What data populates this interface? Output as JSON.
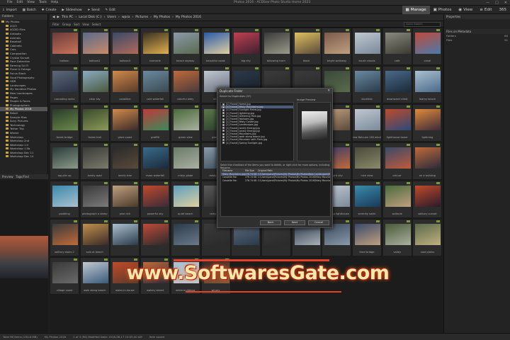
{
  "window": {
    "title": "Photos 2016 - ACDSee Photo Studio Home 2023",
    "menu": [
      "File",
      "Edit",
      "View",
      "Tools",
      "Help"
    ],
    "controls": [
      "—",
      "□",
      "✕"
    ]
  },
  "toolbar": {
    "buttons": [
      "Import",
      "Batch",
      "Create",
      "Slideshow",
      "Send",
      "Edit"
    ],
    "modes": [
      "Manage",
      "Photos",
      "View",
      "Edit",
      "365"
    ]
  },
  "address": {
    "path": [
      "This PC",
      "Local Disk (C:)",
      "Users",
      "wpsa",
      "Pictures",
      "My Photos",
      "My Photos 2016"
    ],
    "filters": [
      "Filter",
      "Group",
      "Sort",
      "View",
      "Select"
    ],
    "search_placeholder": "Quick Search"
  },
  "folders": {
    "header": "Folders",
    "items": [
      {
        "label": "My Photos",
        "sel": false
      },
      {
        "label": "2023",
        "sel": false
      },
      {
        "label": "ACDID Files",
        "sel": false
      },
      {
        "label": "Airboats",
        "sel": false
      },
      {
        "label": "Animals",
        "sel": false
      },
      {
        "label": "Baseball",
        "sel": false
      },
      {
        "label": "Cabinets",
        "sel": false
      },
      {
        "label": "Cars",
        "sel": false
      },
      {
        "label": "Composition",
        "sel": false
      },
      {
        "label": "Crystal Sunset",
        "sel": false
      },
      {
        "label": "Face Detection",
        "sel": false
      },
      {
        "label": "Farming Sci Fi",
        "sel": false
      },
      {
        "label": "Floral & Foliage",
        "sel": false
      },
      {
        "label": "Focus Stack",
        "sel": false
      },
      {
        "label": "Food Photography",
        "sel": false
      },
      {
        "label": "HDR",
        "sel": false
      },
      {
        "label": "Landscapes",
        "sel": false
      },
      {
        "label": "My Vacation Photos",
        "sel": false
      },
      {
        "label": "New Landscapes",
        "sel": false
      },
      {
        "label": "Pages",
        "sel": false
      },
      {
        "label": "People & Faces",
        "sel": false
      },
      {
        "label": "Photographers",
        "sel": false
      },
      {
        "label": "My Photos 2016",
        "sel": true
      },
      {
        "label": "Retail",
        "sel": false
      },
      {
        "label": "Sample Files",
        "sel": false
      },
      {
        "label": "Sony Pictures",
        "sel": false
      },
      {
        "label": "Technology",
        "sel": false
      },
      {
        "label": "Tether Trip",
        "sel": false
      },
      {
        "label": "Winter",
        "sel": false
      },
      {
        "label": "Workshop",
        "sel": false
      },
      {
        "label": "Workshop 2nd",
        "sel": false
      },
      {
        "label": "Workshop 1.0",
        "sel": false
      },
      {
        "label": "Workshop 1.5b",
        "sel": false
      },
      {
        "label": "Workshop Dec 11",
        "sel": false
      },
      {
        "label": "Workshop Dec 14",
        "sel": false
      }
    ]
  },
  "preview": {
    "header": "Preview",
    "tab": "Tags/Find"
  },
  "properties": {
    "header": "Properties",
    "section": "Files on Metadata",
    "rows": [
      {
        "k": "Folders",
        "v": "60"
      },
      {
        "k": "Files",
        "v": "51"
      }
    ]
  },
  "thumbs": [
    {
      "cap": "balloon",
      "c": "#6b3a3a,#c9745a"
    },
    {
      "cap": "balloon2",
      "c": "#5a6a8a,#c98a6a"
    },
    {
      "cap": "balloon3",
      "c": "#3a4a6a,#b06a5a"
    },
    {
      "cap": "barnacle",
      "c": "#3a3020,#e0b050"
    },
    {
      "cap": "beach skyway",
      "c": "#8a9aaa,#5a6a50"
    },
    {
      "cap": "beautiful coast",
      "c": "#2a5aaa,#e0d0a0"
    },
    {
      "cap": "big city",
      "c": "#c04050,#402030"
    },
    {
      "cap": "billowing tram",
      "c": "#3a3a3a,#9a9a8a"
    },
    {
      "cap": "block",
      "c": "#e0c060,#5a4a3a"
    },
    {
      "cap": "bright walkway",
      "c": "#7a5a4a,#c0a080"
    },
    {
      "cap": "brush clouds",
      "c": "#c0c8d0,#7a8a9a"
    },
    {
      "cap": "cafe",
      "c": "#8a8a80,#3a3a30"
    },
    {
      "cap": "canal",
      "c": "#c04a3a,#4a7aaa"
    },
    {
      "cap": "cascading rocks",
      "c": "#5a6a7a,#2a3040"
    },
    {
      "cap": "clear sky",
      "c": "#8aaac0,#4a5a40"
    },
    {
      "cap": "coastline",
      "c": "#d08a4a,#5a3a2a"
    },
    {
      "cap": "cold waterfall",
      "c": "#6a8aa0,#3a4a50"
    },
    {
      "cap": "colorful alley",
      "c": "#c06a3a,#4a3a3a"
    },
    {
      "cap": "city",
      "c": "#c0c8d0,#6a7080"
    },
    {
      "cap": "",
      "c": "#2a3a4a,#1a2028"
    },
    {
      "cap": "",
      "c": "#3a3a3a,#2a2a2a"
    },
    {
      "cap": "",
      "c": "#3a3a3a,#2a2a2a"
    },
    {
      "cap": "",
      "c": "#3a4a3a,#5a6a4a"
    },
    {
      "cap": "docktide",
      "c": "#6a8aa0,#2a3a4a"
    },
    {
      "cap": "downward climb",
      "c": "#4a6a8a,#1a2a3a"
    },
    {
      "cap": "foamy beach",
      "c": "#aac0d0,#4a6a8a"
    },
    {
      "cap": "forest bridge",
      "c": "#2a3a2a,#6a8a4a"
    },
    {
      "cap": "forest trail",
      "c": "#3a4a2a,#8a9a5a"
    },
    {
      "cap": "glare coast",
      "c": "#d08a4a,#3a2a2a"
    },
    {
      "cap": "graffiti",
      "c": "#c03a3a,#3a8a5a"
    },
    {
      "cap": "green view",
      "c": "#4a6a3a,#aab0a0"
    },
    {
      "cap": "green",
      "c": "#5a7a4a,#2a3a2a"
    },
    {
      "cap": "",
      "c": "#3a3a3a,#2a2a2a"
    },
    {
      "cap": "",
      "c": "#3a3a3a,#2a2a2a"
    },
    {
      "cap": "",
      "c": "#3a3a3a,#2a2a2a"
    },
    {
      "cap": "",
      "c": "#c0a080,#5a4a3a"
    },
    {
      "cap": "law Balcuan 180 wind",
      "c": "#c0c8d0,#7a8a9a"
    },
    {
      "cap": "lighthouse tower",
      "c": "#c04a2a,#2a4a7a"
    },
    {
      "cap": "lightning",
      "c": "#e08a3a,#3a2a3a"
    },
    {
      "cap": "log pile up",
      "c": "#2a3a3a,#8a9a8a"
    },
    {
      "cap": "lonely road",
      "c": "#3a3a3a,#7a7a6a"
    },
    {
      "cap": "lonely tree",
      "c": "#2a2a2a,#5a4a3a"
    },
    {
      "cap": "mass waterfall",
      "c": "#3a6a8a,#1a2a3a"
    },
    {
      "cap": "misty glade",
      "c": "#6a7a6a,#aab0a0"
    },
    {
      "cap": "misty pier",
      "c": "#8a9aaa,#3a4a5a"
    },
    {
      "cap": "",
      "c": "#3a3a3a,#2a2a2a"
    },
    {
      "cap": "",
      "c": "#3a3a3a,#2a2a2a"
    },
    {
      "cap": "",
      "c": "#3a3a3a,#2a2a2a"
    },
    {
      "cap": "night city",
      "c": "#3a3a6a,#c06a3a"
    },
    {
      "cap": "nice view",
      "c": "#4a4a3a,#8a8a6a"
    },
    {
      "cap": "old car",
      "c": "#3a4a6a,#c05a3a"
    },
    {
      "cap": "on a building",
      "c": "#c06a3a,#2a2a3a"
    },
    {
      "cap": "paddling",
      "c": "#3a8aaa,#aac0d0"
    },
    {
      "cap": "photograph a damp",
      "c": "#3a3a3a,#7a7a7a"
    },
    {
      "cap": "pine rich",
      "c": "#c0a080,#4a3a2a"
    },
    {
      "cap": "powerful sky",
      "c": "#c04a2a,#3a2a3a"
    },
    {
      "cap": "quiet beach",
      "c": "#5aa0c0,#e0d0a0"
    },
    {
      "cap": "rainy day",
      "c": "#5a5a5a,#2a2a2a"
    },
    {
      "cap": "rolling wave",
      "c": "#3a6a8a,#aac0d0"
    },
    {
      "cap": "sensual Mountains SDRMC",
      "c": "#6a6a7a,#2a2a3a"
    },
    {
      "cap": "skyscraper",
      "c": "#aab0b8,#4a5a6a"
    },
    {
      "cap": "smoking lighthouse",
      "c": "#c0c8d0,#7a8a9a"
    },
    {
      "cap": "serenity swim",
      "c": "#3a8aaa,#1a3a5a"
    },
    {
      "cap": "solitude",
      "c": "#4a6a3a,#c0a080"
    },
    {
      "cap": "solitary sunset",
      "c": "#c04a2a,#2a1a2a"
    },
    {
      "cap": "solitary stairs 2",
      "c": "#3a3a3a,#c06a3a"
    },
    {
      "cap": "solo at beach",
      "c": "#c0904a,#3a2a2a"
    },
    {
      "cap": "",
      "c": "#aac0d0,#2a3a4a"
    },
    {
      "cap": "",
      "c": "#c04a3a,#2a2a2a"
    },
    {
      "cap": "",
      "c": "#2a3a4a,#6a7a8a"
    },
    {
      "cap": "",
      "c": "#3a3a3a,#2a2a2a"
    },
    {
      "cap": "",
      "c": "#5a6a7a,#2a3a4a"
    },
    {
      "cap": "",
      "c": "#3a3a3a,#2a2a2a"
    },
    {
      "cap": "",
      "c": "#2a3a4a,#aab0b8"
    },
    {
      "cap": "",
      "c": "#3a4a5a,#8a9aaa"
    },
    {
      "cap": "tired bridge",
      "c": "#3a4a6a,#c0a080"
    },
    {
      "cap": "valley",
      "c": "#4a5a3a,#aab0a0"
    },
    {
      "cap": "vast plains",
      "c": "#5a6a4a,#c0b080"
    },
    {
      "cap": "village coast",
      "c": "#3a3a3a,#6a6a6a"
    },
    {
      "cap": "walk along beach",
      "c": "#c0c8d0,#3a5a7a"
    },
    {
      "cap": "water-in-house",
      "c": "#c04a2a,#5a3a2a"
    },
    {
      "cap": "watery street",
      "c": "#c06a3a,#2a2a3a"
    },
    {
      "cap": "white buildings",
      "c": "#aac0d0,#c0c8d0"
    },
    {
      "cap": "winery",
      "c": "#3a2a2a,#8a5a3a"
    }
  ],
  "dialog": {
    "title": "Duplicate Finder",
    "subtitle": "Select to Duplicates (37)",
    "files": [
      "[1] Found] forest.jpg",
      "[1] Found] Misty Mountains.jpg",
      "[1] Found] Sunlight Fields.jpg",
      "[1] Found] lightning.jpg",
      "[1] Found] Glittering Park.jpg",
      "[1] Found] fashown.jpg",
      "[1] Found] Misty Castle.jpg",
      "[1] Found] Landscapes.jpg",
      "[1] Found] lonely Energy.jpg",
      "[1] Found] lonely Energy.jpg",
      "[1] Found] Mountains.jpg",
      "[1] Found] walk along beach.jpg",
      "[1] Found] Mountain with Plain.jpg",
      "[1] Found] Spring Sunlight.jpg"
    ],
    "preview_label": "Image Preview",
    "instructions": "Select the checkbox of the items you want to delete, or right click for more options, including Rename.",
    "table_header": [
      "Filename",
      "File Size",
      "Original Path"
    ],
    "table_rows": [
      [
        "Misty Mountains.jpg",
        "276.74 KB",
        "C:\\Users\\pano\\Pictures\\My Photos\\My Photos\\New Landscapes\\Misty Mountains"
      ],
      [
        "Cassette Fan",
        "276.74 KB",
        "C:\\Users\\pano\\Pictures\\My Photos\\My Photos 2016\\Misty Mountains"
      ],
      [
        "Cassette Fan",
        "276.74 KB",
        "C:\\Users\\pano\\Pictures\\My Photos\\My Photos 2016\\Misty Mountains"
      ]
    ],
    "buttons": [
      "Back",
      "Next",
      "Cancel"
    ]
  },
  "statusbar": {
    "items": [
      "Total 96 items (194.8 MB)",
      "My Photos 2016",
      "1 of 4 (96) Modified Date: 2016-06-17 10:05:40 AM",
      "Item saved"
    ]
  },
  "watermark": "www.SoftwaresGate.com"
}
